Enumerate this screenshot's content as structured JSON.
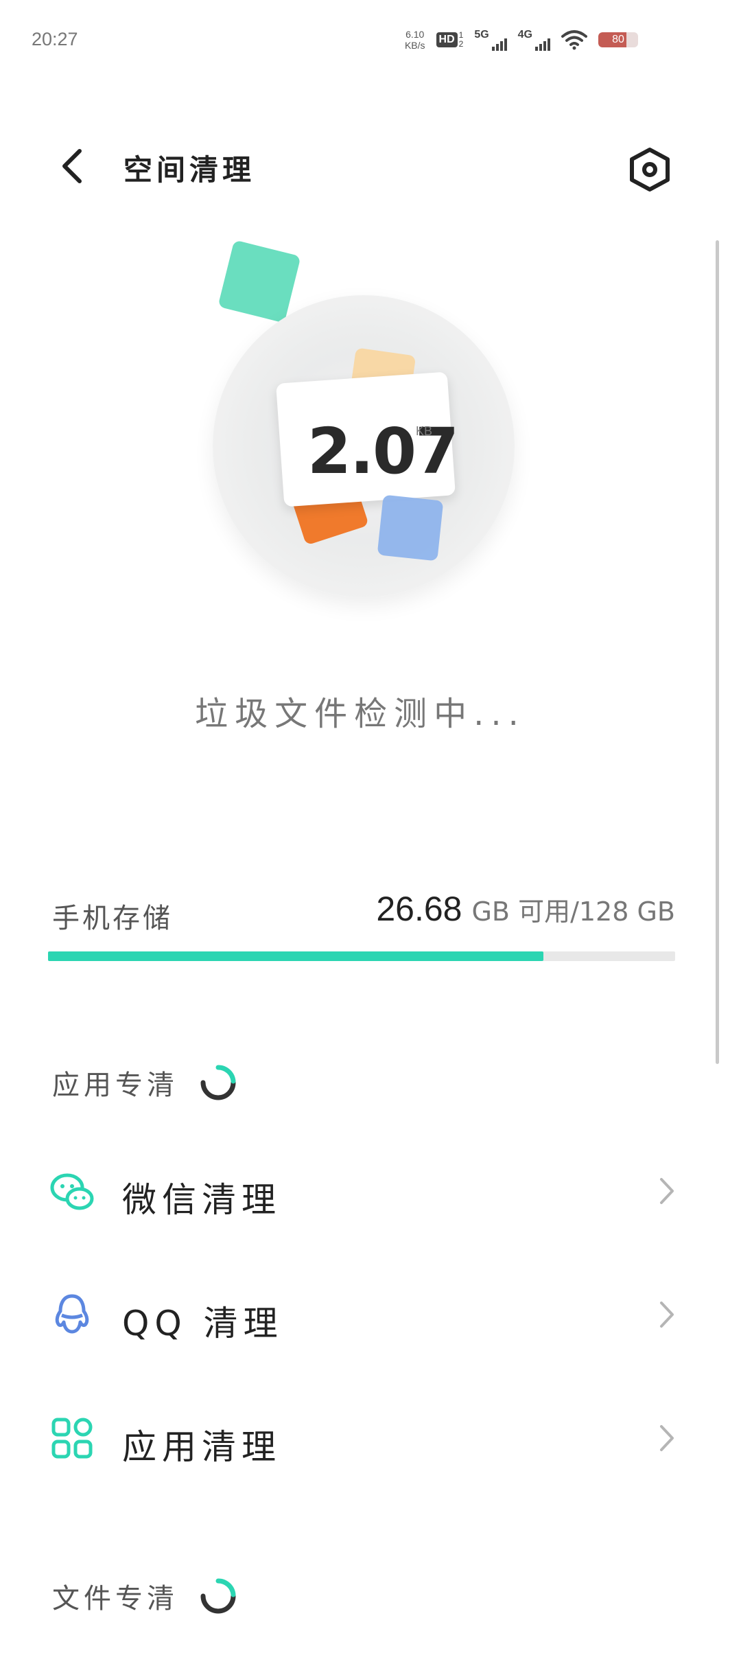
{
  "status_bar": {
    "time": "20:27",
    "net_speed_value": "6.10",
    "net_speed_unit": "KB/s",
    "hd_label": "HD",
    "hd_sim_top": "1",
    "hd_sim_bottom": "2",
    "signal1_label": "5G",
    "signal2_label": "4G",
    "battery_level": "80"
  },
  "header": {
    "title": "空间清理"
  },
  "scan": {
    "size_value": "2.07",
    "size_unit": "KB",
    "status_text": "垃圾文件检测中..."
  },
  "storage": {
    "label": "手机存储",
    "free_value": "26.68",
    "unit_text": "GB 可用/128 GB",
    "used_fraction": 0.79,
    "bar_color": "#2bd5b2"
  },
  "sections": {
    "app_clean_title": "应用专清",
    "file_clean_title": "文件专清"
  },
  "app_items": [
    {
      "label": "微信清理",
      "icon": "wechat-icon"
    },
    {
      "label": "QQ 清理",
      "icon": "qq-icon"
    },
    {
      "label": "应用清理",
      "icon": "apps-grid-icon"
    }
  ],
  "colors": {
    "accent": "#2bd5b2",
    "qq_blue": "#5c87e0"
  }
}
